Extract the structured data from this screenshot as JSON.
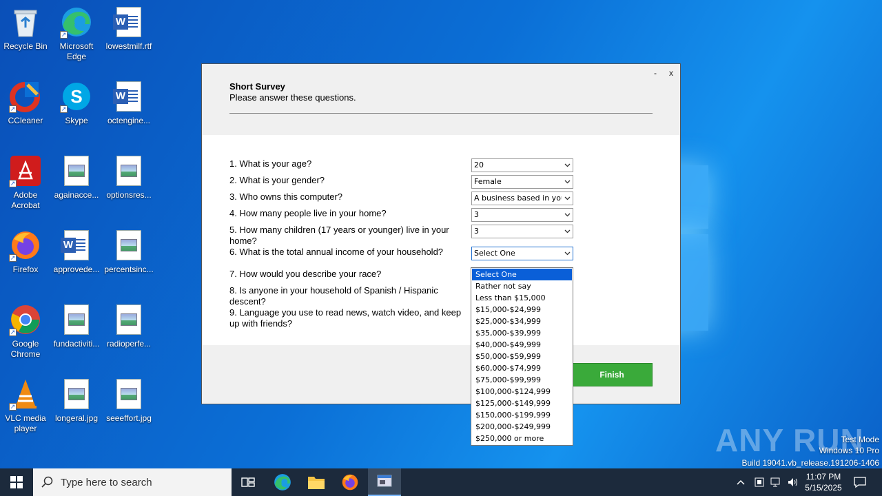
{
  "desktop": {
    "icons": [
      {
        "label": "Recycle Bin"
      },
      {
        "label": "Microsoft Edge"
      },
      {
        "label": "lowestmilf.rtf"
      },
      {
        "label": "CCleaner"
      },
      {
        "label": "Skype"
      },
      {
        "label": "octengine..."
      },
      {
        "label": "Adobe Acrobat"
      },
      {
        "label": "againacce..."
      },
      {
        "label": "optionsres..."
      },
      {
        "label": "Firefox"
      },
      {
        "label": "approvede..."
      },
      {
        "label": "percentsinc..."
      },
      {
        "label": "Google Chrome"
      },
      {
        "label": "fundactiviti..."
      },
      {
        "label": "radioperfe..."
      },
      {
        "label": "VLC media player"
      },
      {
        "label": "longeral.jpg"
      },
      {
        "label": "seeeffort.jpg"
      }
    ]
  },
  "dialog": {
    "minimize": "-",
    "close": "x",
    "title": "Short Survey",
    "subtitle": "Please answer these questions.",
    "questions": [
      {
        "text": "1. What is your age?",
        "value": "20"
      },
      {
        "text": "2. What is your gender?",
        "value": "Female"
      },
      {
        "text": "3. Who owns this computer?",
        "value": "A business based in you"
      },
      {
        "text": "4. How many people live in your home?",
        "value": "3"
      },
      {
        "text": "5. How many children (17 years or younger) live in your home?",
        "value": "3"
      },
      {
        "text": "6. What is the total annual income of your household?",
        "value": "Select One"
      },
      {
        "text": "7. How would you describe your race?"
      },
      {
        "text": "8. Is anyone in your household of Spanish / Hispanic descent?"
      },
      {
        "text": "9. Language you use to read news, watch video, and keep up with friends?"
      }
    ],
    "finish_label": "Finish"
  },
  "income_dropdown": {
    "selected": "Select One",
    "options": [
      "Select One",
      "Rather not say",
      "Less than $15,000",
      "$15,000-$24,999",
      "$25,000-$34,999",
      "$35,000-$39,999",
      "$40,000-$49,999",
      "$50,000-$59,999",
      "$60,000-$74,999",
      "$75,000-$99,999",
      "$100,000-$124,999",
      "$125,000-$149,999",
      "$150,000-$199,999",
      "$200,000-$249,999",
      "$250,000 or more"
    ]
  },
  "watermark": {
    "brand": "ANY RUN",
    "mode": "Test Mode",
    "os": "Windows 10 Pro",
    "build": "Build 19041.vb_release.191206-1406"
  },
  "taskbar": {
    "search_placeholder": "Type here to search",
    "time": "11:07 PM",
    "date": "5/15/2025"
  },
  "colors": {
    "accent": "#0a5fd8",
    "finish": "#3aaa3a"
  }
}
